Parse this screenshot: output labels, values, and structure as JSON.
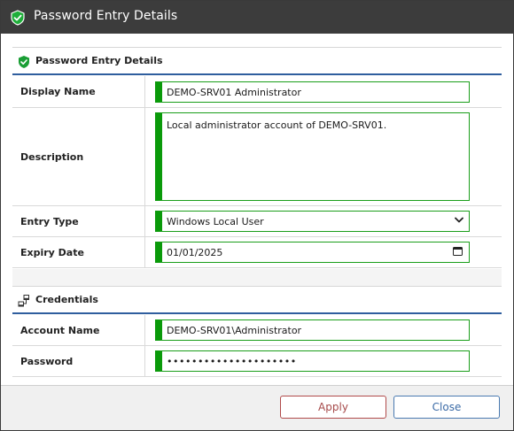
{
  "window": {
    "title": "Password Entry Details",
    "icon": "shield-check-icon"
  },
  "sections": {
    "details": {
      "heading": "Password Entry Details",
      "icon": "shield-check-icon"
    },
    "credentials": {
      "heading": "Credentials",
      "icon": "network-users-icon"
    }
  },
  "fields": {
    "display_name": {
      "label": "Display Name",
      "value": "DEMO-SRV01 Administrator"
    },
    "description": {
      "label": "Description",
      "value": "Local administrator account of DEMO-SRV01."
    },
    "entry_type": {
      "label": "Entry Type",
      "value": "Windows Local User"
    },
    "expiry_date": {
      "label": "Expiry Date",
      "value": "01/01/2025"
    },
    "account_name": {
      "label": "Account Name",
      "value": "DEMO-SRV01\\Administrator"
    },
    "password": {
      "label": "Password",
      "value": "•••••••••••••••••••••"
    }
  },
  "buttons": {
    "apply": "Apply",
    "close": "Close"
  },
  "colors": {
    "titlebar": "#3c3c3c",
    "accent_green": "#0a9a0a",
    "section_rule": "#2f5e9e",
    "apply": "#a64a4a",
    "close": "#3a6aa6"
  }
}
